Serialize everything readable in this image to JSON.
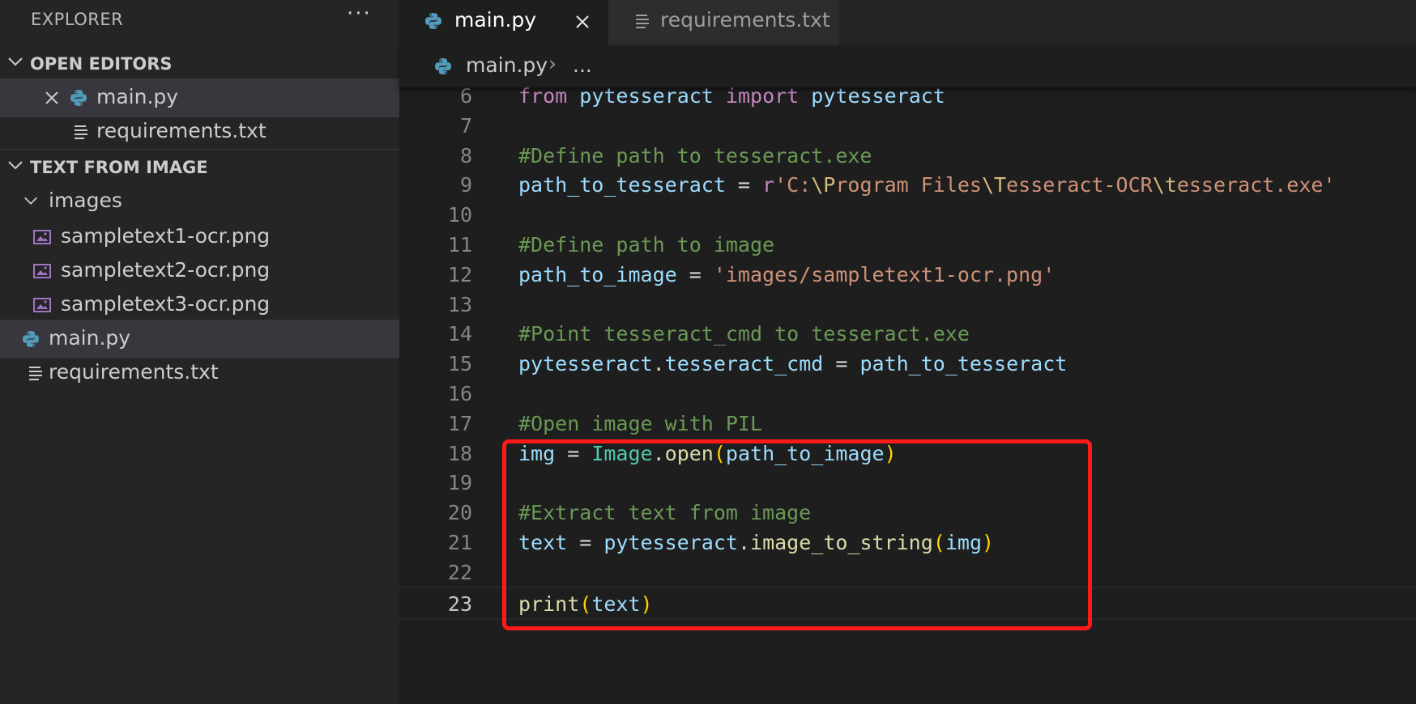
{
  "explorer": {
    "title": "EXPLORER",
    "more": "···",
    "open_editors": {
      "label": "OPEN EDITORS",
      "items": [
        {
          "label": "main.py",
          "icon": "python-icon"
        },
        {
          "label": "requirements.txt",
          "icon": "text-file-icon"
        }
      ]
    },
    "project": {
      "label": "TEXT FROM IMAGE",
      "folder": "images",
      "images": [
        "sampletext1-ocr.png",
        "sampletext2-ocr.png",
        "sampletext3-ocr.png"
      ],
      "files": [
        "main.py",
        "requirements.txt"
      ]
    }
  },
  "tabs": [
    {
      "label": "main.py",
      "active": true,
      "icon": "python-icon"
    },
    {
      "label": "requirements.txt",
      "active": false,
      "icon": "text-file-icon"
    }
  ],
  "breadcrumb": {
    "file": "main.py",
    "separator": "›",
    "ellipsis": "..."
  },
  "editor": {
    "current_line": 23,
    "lines": [
      {
        "num": "6",
        "tokens": [
          [
            "kw",
            "from"
          ],
          [
            "op",
            " "
          ],
          [
            "var",
            "pytesseract"
          ],
          [
            "op",
            " "
          ],
          [
            "kw",
            "import"
          ],
          [
            "op",
            " "
          ],
          [
            "var",
            "pytesseract"
          ]
        ]
      },
      {
        "num": "7",
        "tokens": []
      },
      {
        "num": "8",
        "tokens": [
          [
            "cmt",
            "#Define path to tesseract.exe"
          ]
        ]
      },
      {
        "num": "9",
        "tokens": [
          [
            "var",
            "path_to_tesseract"
          ],
          [
            "op",
            " = "
          ],
          [
            "kw",
            "r"
          ],
          [
            "str",
            "'C:"
          ],
          [
            "esc",
            "\\P"
          ],
          [
            "str",
            "rogram Files"
          ],
          [
            "esc",
            "\\T"
          ],
          [
            "str",
            "esseract-OCR"
          ],
          [
            "esc",
            "\\t"
          ],
          [
            "str",
            "esseract.exe'"
          ]
        ]
      },
      {
        "num": "10",
        "tokens": []
      },
      {
        "num": "11",
        "tokens": [
          [
            "cmt",
            "#Define path to image"
          ]
        ]
      },
      {
        "num": "12",
        "tokens": [
          [
            "var",
            "path_to_image"
          ],
          [
            "op",
            " = "
          ],
          [
            "str",
            "'images/sampletext1-ocr.png'"
          ]
        ]
      },
      {
        "num": "13",
        "tokens": []
      },
      {
        "num": "14",
        "tokens": [
          [
            "cmt",
            "#Point tesseract_cmd to tesseract.exe"
          ]
        ]
      },
      {
        "num": "15",
        "tokens": [
          [
            "var",
            "pytesseract"
          ],
          [
            "op",
            "."
          ],
          [
            "var",
            "tesseract_cmd"
          ],
          [
            "op",
            " = "
          ],
          [
            "var",
            "path_to_tesseract"
          ]
        ]
      },
      {
        "num": "16",
        "tokens": []
      },
      {
        "num": "17",
        "tokens": [
          [
            "cmt",
            "#Open image with PIL"
          ]
        ]
      },
      {
        "num": "18",
        "tokens": [
          [
            "var",
            "img"
          ],
          [
            "op",
            " = "
          ],
          [
            "cls",
            "Image"
          ],
          [
            "op",
            "."
          ],
          [
            "fn",
            "open"
          ],
          [
            "br",
            "("
          ],
          [
            "var",
            "path_to_image"
          ],
          [
            "br",
            ")"
          ]
        ]
      },
      {
        "num": "19",
        "tokens": []
      },
      {
        "num": "20",
        "tokens": [
          [
            "cmt",
            "#Extract text from image"
          ]
        ]
      },
      {
        "num": "21",
        "tokens": [
          [
            "var",
            "text"
          ],
          [
            "op",
            " = "
          ],
          [
            "var",
            "pytesseract"
          ],
          [
            "op",
            "."
          ],
          [
            "fn",
            "image_to_string"
          ],
          [
            "br",
            "("
          ],
          [
            "var",
            "img"
          ],
          [
            "br",
            ")"
          ]
        ]
      },
      {
        "num": "22",
        "tokens": []
      },
      {
        "num": "23",
        "tokens": [
          [
            "fn",
            "print"
          ],
          [
            "br",
            "("
          ],
          [
            "var",
            "text"
          ],
          [
            "br",
            ")"
          ]
        ]
      }
    ]
  },
  "colors": {
    "highlight_box": "#ff1a1a",
    "python_icon": "#519aba",
    "image_icon": "#a074c4"
  }
}
